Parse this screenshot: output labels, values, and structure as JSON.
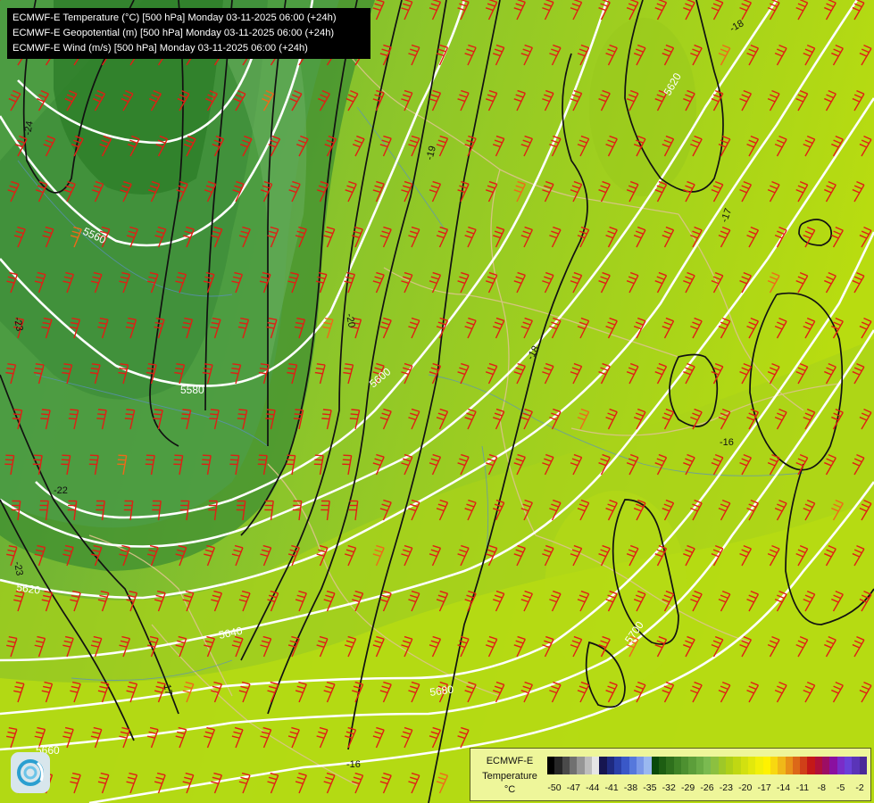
{
  "header": {
    "line1": "ECMWF-E Temperature (°C) [500 hPa] Monday 03-11-2025 06:00 (+24h)",
    "line2": "ECMWF-E Geopotential (m) [500 hPa] Monday 03-11-2025 06:00 (+24h)",
    "line3": "ECMWF-E Wind (m/s) [500 hPa] Monday 03-11-2025 06:00 (+24h)"
  },
  "contour_labels": {
    "geo_5560": "5560",
    "geo_5580": "5580",
    "geo_5600": "5600",
    "geo_5620a": "5620",
    "geo_5620b": "5620",
    "geo_5640": "5640",
    "geo_5660": "5660",
    "geo_5680": "5680",
    "geo_5700": "5700",
    "t_m24": "-24",
    "t_m23": "-23",
    "t_m22": "-22",
    "t_m21": "-21",
    "t_m20": "-20",
    "t_m19": "-19",
    "t_m18a": "-18",
    "t_m18b": "-18",
    "t_m17": "-17",
    "t_m16a": "-16",
    "t_m16b": "-16",
    "t_m23b": "-23",
    "t_m17b": "-17"
  },
  "legend": {
    "model": "ECMWF-E",
    "variable": "Temperature",
    "unit": "°C",
    "ticks": [
      "-50",
      "-47",
      "-44",
      "-41",
      "-38",
      "-35",
      "-32",
      "-29",
      "-26",
      "-23",
      "-20",
      "-17",
      "-14",
      "-11",
      "-8",
      "-5",
      "-2"
    ],
    "colors": [
      "#000000",
      "#262626",
      "#4a4a4a",
      "#707070",
      "#969696",
      "#bdbdbd",
      "#e5e5e5",
      "#161650",
      "#1e2a80",
      "#2a40a8",
      "#3a58c8",
      "#5678dc",
      "#7a98e8",
      "#9ab8f0",
      "#0a4a0a",
      "#1d5e12",
      "#2e701c",
      "#3e8226",
      "#4d9030",
      "#5c9e3a",
      "#6aac44",
      "#7aba50",
      "#8cc040",
      "#9ec828",
      "#aed018",
      "#c0d812",
      "#d2e010",
      "#e2e80c",
      "#f2f008",
      "#fff200",
      "#f8d810",
      "#f0b818",
      "#e89018",
      "#dc6818",
      "#d04018",
      "#c41818",
      "#b0103a",
      "#9c0e64",
      "#8a10a0",
      "#7a2cc8",
      "#6a40d8",
      "#5a34b8",
      "#4a2898"
    ],
    "highlight_colors": {
      "barb_red": "#e01e14",
      "barb_orange": "#f06818",
      "geopotential": "#ffffff",
      "temperature": "#111111",
      "borders": "#dcc48c"
    }
  },
  "icons": {
    "logo": "meteo-logo-icon"
  }
}
